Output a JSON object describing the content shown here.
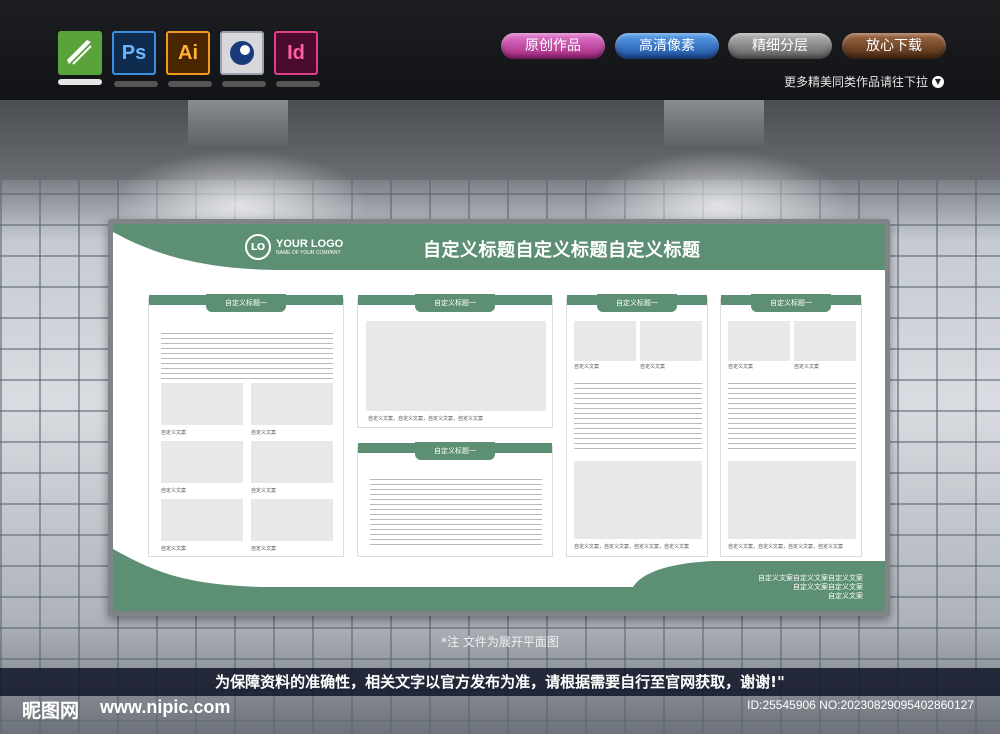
{
  "toolbar": {
    "software": [
      {
        "name": "coreldraw-icon",
        "label": ""
      },
      {
        "name": "photoshop-icon",
        "label": "Ps"
      },
      {
        "name": "illustrator-icon",
        "label": "Ai"
      },
      {
        "name": "cinema4d-icon",
        "label": ""
      },
      {
        "name": "indesign-icon",
        "label": "Id"
      }
    ],
    "buttons": [
      "原创作品",
      "高清像素",
      "精细分层",
      "放心下载"
    ],
    "more_text": "更多精美同类作品请往下拉"
  },
  "board": {
    "logo_main": "YOUR LOGO",
    "logo_sub": "NAME OF YOUR COMPANY",
    "title": "自定义标题自定义标题自定义标题",
    "section_title": "自定义标题一",
    "caption": "自定义文案",
    "caption_long": "自定义文案，自定义文案，自定义文案，自定义文案",
    "footer_lines": [
      "自定义文案自定义文案自定义文案",
      "自定义文案自定义文案",
      "自定义文案"
    ]
  },
  "note": "*注  文件为展开平面图",
  "disclaimer": "为保障资料的准确性，相关文字以官方发布为准，请根据需要自行至官网获取，谢谢!\"",
  "watermark": {
    "brand": "昵图网",
    "url": "www.nipic.com",
    "id": "ID:25545906 NO:20230829095402860127"
  },
  "colors": {
    "accent": "#5c8f74"
  }
}
